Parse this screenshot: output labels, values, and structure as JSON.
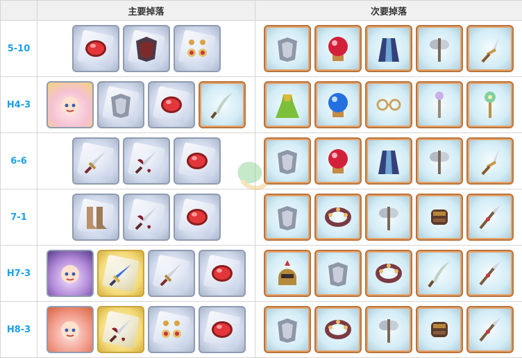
{
  "table": {
    "header": {
      "main_drops": "主要掉落",
      "secondary_drops": "次要掉落"
    },
    "rows": [
      {
        "stage": "5-10",
        "main": [
          {
            "icon": "red-gem-icon",
            "frame": "silver",
            "shard": true
          },
          {
            "icon": "dark-armor-icon",
            "frame": "silver",
            "shard": true
          },
          {
            "icon": "earrings-icon",
            "frame": "silver",
            "shard": true
          }
        ],
        "secondary": [
          {
            "icon": "armor-icon",
            "frame": "copper"
          },
          {
            "icon": "red-orb-icon",
            "frame": "copper"
          },
          {
            "icon": "robe-icon",
            "frame": "copper"
          },
          {
            "icon": "axe-icon",
            "frame": "copper"
          },
          {
            "icon": "dagger-icon",
            "frame": "copper"
          }
        ]
      },
      {
        "stage": "H4-3",
        "main": [
          {
            "icon": "character-portrait-icon",
            "frame": "portrait-blonde"
          },
          {
            "icon": "armor-icon",
            "frame": "silver",
            "shard": true
          },
          {
            "icon": "red-gem-icon",
            "frame": "silver",
            "shard": true
          },
          {
            "icon": "scimitar-icon",
            "frame": "copper"
          }
        ],
        "secondary": [
          {
            "icon": "dress-icon",
            "frame": "copper"
          },
          {
            "icon": "blue-orb-icon",
            "frame": "copper"
          },
          {
            "icon": "glasses-icon",
            "frame": "copper"
          },
          {
            "icon": "staff-icon",
            "frame": "copper"
          },
          {
            "icon": "flower-staff-icon",
            "frame": "copper"
          }
        ]
      },
      {
        "stage": "6-6",
        "main": [
          {
            "icon": "sword-icon",
            "frame": "silver",
            "shard": true
          },
          {
            "icon": "winged-sword-icon",
            "frame": "silver",
            "shard": true
          },
          {
            "icon": "red-gem-icon",
            "frame": "silver",
            "shard": true
          }
        ],
        "secondary": [
          {
            "icon": "armor-icon",
            "frame": "copper"
          },
          {
            "icon": "red-orb-icon",
            "frame": "copper"
          },
          {
            "icon": "robe-icon",
            "frame": "copper"
          },
          {
            "icon": "axe-icon",
            "frame": "copper"
          },
          {
            "icon": "dagger-icon",
            "frame": "copper"
          }
        ]
      },
      {
        "stage": "7-1",
        "main": [
          {
            "icon": "boots-icon",
            "frame": "silver",
            "shard": true
          },
          {
            "icon": "winged-sword-icon",
            "frame": "silver",
            "shard": true
          },
          {
            "icon": "red-gem-icon",
            "frame": "silver",
            "shard": true
          }
        ],
        "secondary": [
          {
            "icon": "armor-icon",
            "frame": "copper"
          },
          {
            "icon": "bracelet-icon",
            "frame": "copper"
          },
          {
            "icon": "axe-icon",
            "frame": "copper"
          },
          {
            "icon": "gauntlet-icon",
            "frame": "copper"
          },
          {
            "icon": "spear-icon",
            "frame": "copper"
          }
        ]
      },
      {
        "stage": "H7-3",
        "main": [
          {
            "icon": "character-portrait-icon",
            "frame": "portrait-violet"
          },
          {
            "icon": "blue-sword-icon",
            "frame": "gold",
            "shard": true
          },
          {
            "icon": "sword-icon",
            "frame": "silver",
            "shard": true
          },
          {
            "icon": "red-gem-icon",
            "frame": "silver",
            "shard": true
          }
        ],
        "secondary": [
          {
            "icon": "helmet-icon",
            "frame": "copper"
          },
          {
            "icon": "armor-icon",
            "frame": "copper"
          },
          {
            "icon": "bracelet-icon",
            "frame": "copper"
          },
          {
            "icon": "scimitar-icon",
            "frame": "copper"
          },
          {
            "icon": "spear-icon",
            "frame": "copper"
          }
        ]
      },
      {
        "stage": "H8-3",
        "main": [
          {
            "icon": "character-portrait-icon",
            "frame": "portrait-pink"
          },
          {
            "icon": "winged-sword-icon",
            "frame": "gold",
            "shard": true
          },
          {
            "icon": "earrings-icon",
            "frame": "silver",
            "shard": true
          },
          {
            "icon": "red-gem-icon",
            "frame": "silver",
            "shard": true
          }
        ],
        "secondary": [
          {
            "icon": "armor-icon",
            "frame": "copper"
          },
          {
            "icon": "bracelet-icon",
            "frame": "copper"
          },
          {
            "icon": "axe-icon",
            "frame": "copper"
          },
          {
            "icon": "gauntlet-icon",
            "frame": "copper"
          },
          {
            "icon": "spear-icon",
            "frame": "copper"
          }
        ]
      }
    ]
  },
  "colors": {
    "stage_label": "#1aa1e8",
    "header_bg": "#f0f0f0",
    "border": "#d4d4d4"
  }
}
